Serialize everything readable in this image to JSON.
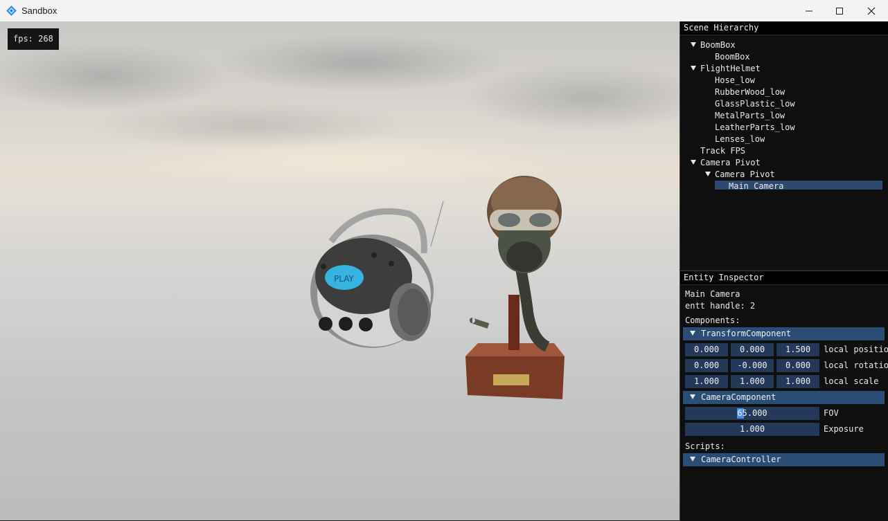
{
  "window": {
    "title": "Sandbox",
    "icon": "app-logo-icon",
    "buttons": [
      "minimize-icon",
      "maximize-icon",
      "close-icon"
    ]
  },
  "viewport": {
    "fps_text": "fps: 268",
    "boombox_label": "PLAY"
  },
  "scene_hierarchy": {
    "title": "Scene Hierarchy",
    "items": [
      {
        "label": "BoomBox",
        "expanded": true
      },
      {
        "label": "BoomBox"
      },
      {
        "label": "FlightHelmet",
        "expanded": true
      },
      {
        "label": "Hose_low"
      },
      {
        "label": "RubberWood_low"
      },
      {
        "label": "GlassPlastic_low"
      },
      {
        "label": "MetalParts_low"
      },
      {
        "label": "LeatherParts_low"
      },
      {
        "label": "Lenses_low"
      },
      {
        "label": "Track FPS"
      },
      {
        "label": "Camera Pivot",
        "expanded": true
      },
      {
        "label": "Camera Pivot",
        "expanded": true
      },
      {
        "label": "Main Camera",
        "selected": true
      }
    ]
  },
  "inspector": {
    "title": "Entity Inspector",
    "entity_name": "Main Camera",
    "entt_handle": "entt handle: 2",
    "components_label": "Components:",
    "transform": {
      "header": "TransformComponent",
      "position": {
        "x": "0.000",
        "y": "0.000",
        "z": "1.500",
        "label": "local position"
      },
      "rotation": {
        "x": "0.000",
        "y": "-0.000",
        "z": "0.000",
        "label": "local rotation"
      },
      "scale": {
        "x": "1.000",
        "y": "1.000",
        "z": "1.000",
        "label": "local scale"
      }
    },
    "camera": {
      "header": "CameraComponent",
      "fov": {
        "value": "65.000",
        "label": "FOV"
      },
      "exposure": {
        "value": "1.000",
        "label": "Exposure"
      }
    },
    "scripts_label": "Scripts:",
    "script": {
      "header": "CameraController"
    }
  }
}
